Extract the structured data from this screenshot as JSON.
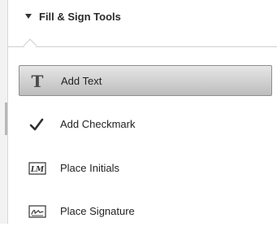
{
  "panel": {
    "section_title": "Fill & Sign Tools",
    "expanded": true
  },
  "tools": [
    {
      "label": "Add Text",
      "icon": "text-T-icon",
      "selected": true,
      "glyph": "T"
    },
    {
      "label": "Add Checkmark",
      "icon": "checkmark-icon",
      "selected": false
    },
    {
      "label": "Place Initials",
      "icon": "initials-icon",
      "selected": false,
      "glyph": "LM"
    },
    {
      "label": "Place Signature",
      "icon": "signature-icon",
      "selected": false
    }
  ],
  "colors": {
    "selected_fill_top": "#e6e6e6",
    "selected_fill_bottom": "#bdbdbd",
    "text": "#222222"
  }
}
